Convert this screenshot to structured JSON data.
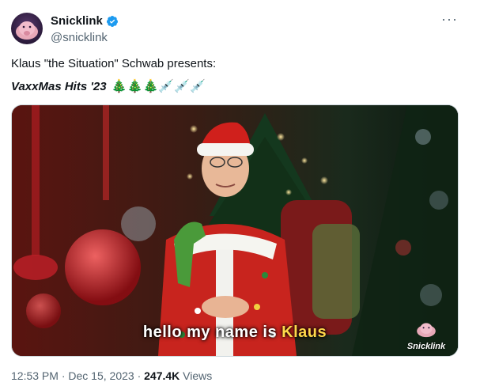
{
  "author": {
    "display_name": "Snicklink",
    "handle": "@snicklink",
    "verified": true
  },
  "more_label": "···",
  "tweet": {
    "line1": "Klaus \"the Situation\" Schwab presents:",
    "line2_title": "VaxxMas Hits '23",
    "line2_emojis": "🎄🎄🎄💉💉💉"
  },
  "media": {
    "caption_prefix": "hello my name is ",
    "caption_highlight": "Klaus",
    "watermark_text": "Snicklink"
  },
  "meta": {
    "time": "12:53 PM",
    "sep1": " · ",
    "date": "Dec 15, 2023",
    "sep2": " · ",
    "views_count": "247.4K",
    "views_label": " Views"
  },
  "colors": {
    "verified": "#1d9bf0",
    "muted_text": "#536471",
    "caption_highlight": "#ffd84a"
  },
  "icons": [
    "avatar-blob-icon",
    "verified-badge-icon",
    "more-options-icon"
  ]
}
